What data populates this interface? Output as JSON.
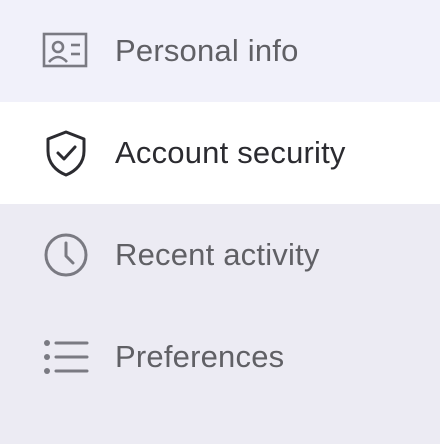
{
  "sidebar": {
    "items": [
      {
        "label": "Personal info",
        "icon": "id-card-icon",
        "selected": false
      },
      {
        "label": "Account security",
        "icon": "shield-check-icon",
        "selected": true
      },
      {
        "label": "Recent activity",
        "icon": "clock-icon",
        "selected": false
      },
      {
        "label": "Preferences",
        "icon": "list-icon",
        "selected": false
      }
    ]
  },
  "colors": {
    "selected_bg": "#ffffff",
    "hover_bg": "#f1f1fa",
    "panel_bg": "#ecebf3",
    "icon_muted": "#7a7a82",
    "icon_active": "#2b2b30"
  }
}
